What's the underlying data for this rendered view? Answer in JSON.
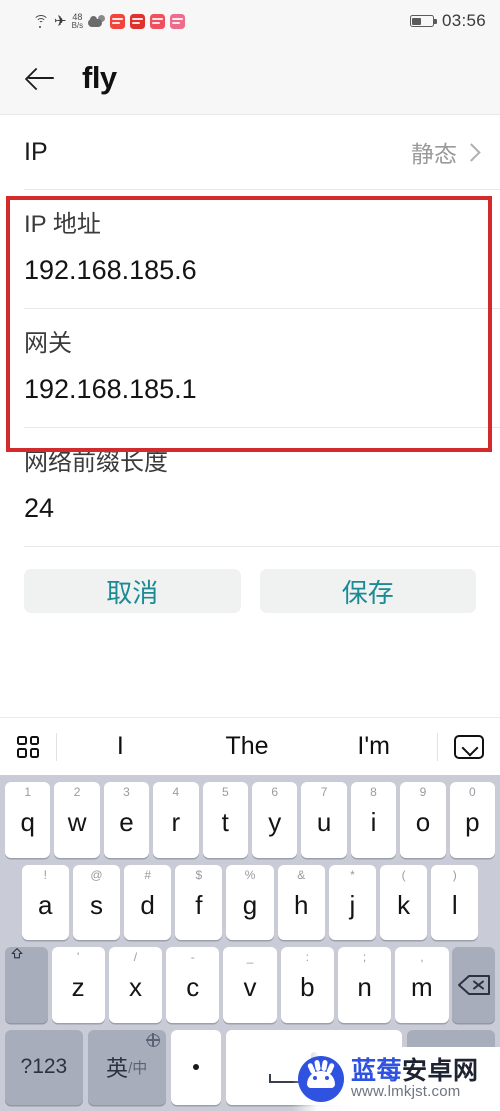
{
  "status_bar": {
    "network_speed_value": "48",
    "network_speed_unit": "B/s",
    "time": "03:56",
    "icons": [
      "wifi-icon",
      "airplane-mode-icon",
      "weather-icon",
      "app-notification-icon",
      "app-notification-icon",
      "app-notification-icon",
      "app-notification-icon",
      "battery-icon"
    ],
    "app_icon_colors": [
      "#f0443c",
      "#e0322c",
      "#ef4f5e",
      "#ee6b8c"
    ],
    "battery_level_percent": 40
  },
  "header": {
    "back_icon": "back-arrow-icon",
    "title": "fly"
  },
  "form": {
    "ip_row": {
      "label": "IP",
      "value": "静态",
      "chevron": "chevron-right-icon"
    },
    "fields": [
      {
        "label": "IP 地址",
        "value": "192.168.185.6"
      },
      {
        "label": "网关",
        "value": "192.168.185.1"
      },
      {
        "label": "网络前缀长度",
        "value": "24"
      }
    ],
    "highlight_color": "#d32b2b"
  },
  "buttons": {
    "cancel_label": "取消",
    "save_label": "保存",
    "accent_color": "#1b8a94"
  },
  "suggestion_bar": {
    "grid_icon": "grid-menu-icon",
    "words": [
      "I",
      "The",
      "I'm"
    ],
    "collapse_icon": "chevron-down-boxed-icon"
  },
  "keyboard": {
    "row1": [
      {
        "main": "q",
        "alt": "1"
      },
      {
        "main": "w",
        "alt": "2"
      },
      {
        "main": "e",
        "alt": "3"
      },
      {
        "main": "r",
        "alt": "4"
      },
      {
        "main": "t",
        "alt": "5"
      },
      {
        "main": "y",
        "alt": "6"
      },
      {
        "main": "u",
        "alt": "7"
      },
      {
        "main": "i",
        "alt": "8"
      },
      {
        "main": "o",
        "alt": "9"
      },
      {
        "main": "p",
        "alt": "0"
      }
    ],
    "row2": [
      {
        "main": "a",
        "alt": "!"
      },
      {
        "main": "s",
        "alt": "@"
      },
      {
        "main": "d",
        "alt": "#"
      },
      {
        "main": "f",
        "alt": "$"
      },
      {
        "main": "g",
        "alt": "%"
      },
      {
        "main": "h",
        "alt": "&"
      },
      {
        "main": "j",
        "alt": "*"
      },
      {
        "main": "k",
        "alt": "("
      },
      {
        "main": "l",
        "alt": ")"
      }
    ],
    "row3": [
      {
        "main": "z",
        "alt": "'"
      },
      {
        "main": "x",
        "alt": "/"
      },
      {
        "main": "c",
        "alt": "-"
      },
      {
        "main": "v",
        "alt": "_"
      },
      {
        "main": "b",
        "alt": ":"
      },
      {
        "main": "n",
        "alt": ";"
      },
      {
        "main": "m",
        "alt": ","
      }
    ],
    "shift_icon": "shift-icon",
    "backspace_icon": "backspace-icon",
    "symbols_label": "?123",
    "lang_main": "英",
    "lang_sub": "/中",
    "lang_globe_icon": "globe-icon",
    "period_label": ".",
    "space_mic_icon": "microphone-icon",
    "background_color": "#c9ccd6"
  },
  "watermark": {
    "brand_blue": "蓝莓",
    "brand_dark": "安卓网",
    "url": "www.lmkjst.com",
    "logo_icon": "android-robot-logo-icon"
  }
}
